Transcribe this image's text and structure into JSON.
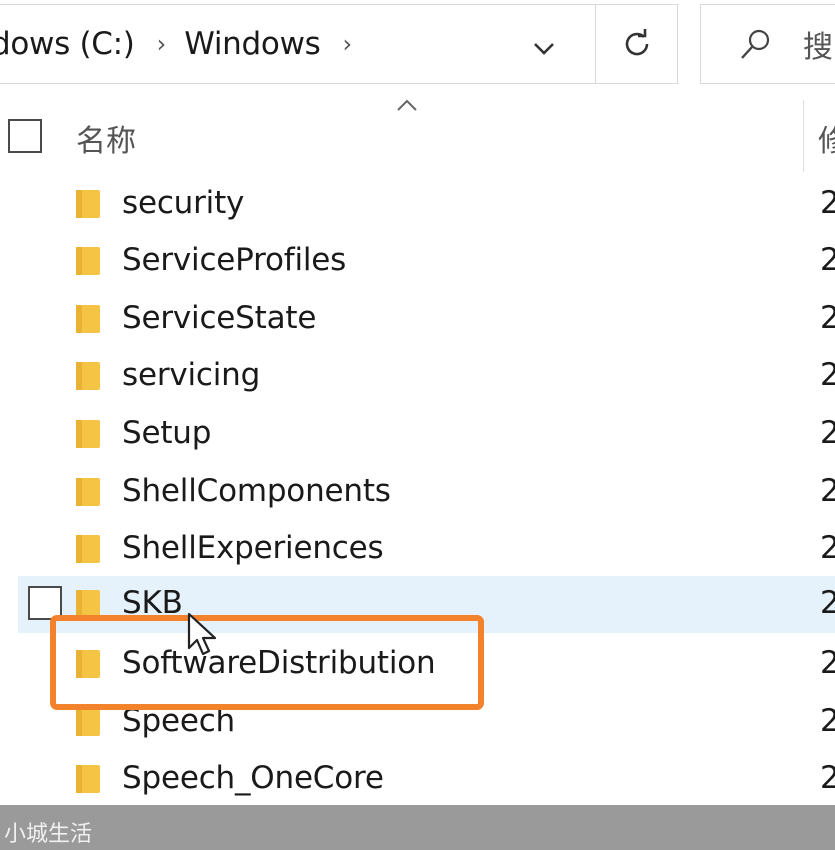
{
  "address_bar": {
    "drive_crumb": "dows (C:)",
    "folder_crumb": "Windows",
    "sep": "›"
  },
  "search": {
    "placeholder": "搜"
  },
  "header": {
    "name_label": "名称",
    "date_label": "修"
  },
  "rows": [
    {
      "name": "security",
      "date": "2"
    },
    {
      "name": "ServiceProfiles",
      "date": "2"
    },
    {
      "name": "ServiceState",
      "date": "2"
    },
    {
      "name": "servicing",
      "date": "2"
    },
    {
      "name": "Setup",
      "date": "2"
    },
    {
      "name": "ShellComponents",
      "date": "2"
    },
    {
      "name": "ShellExperiences",
      "date": "2"
    },
    {
      "name": "SKB",
      "date": "2"
    },
    {
      "name": "SoftwareDistribution",
      "date": "2"
    },
    {
      "name": "Speech",
      "date": "2"
    },
    {
      "name": "Speech_OneCore",
      "date": "2"
    }
  ],
  "watermark": "小城生活",
  "colors": {
    "folder": "#f6c445",
    "hover_row": "#e5f1fb",
    "highlight": "#f2822b"
  },
  "icons": [
    "chevron-down-icon",
    "refresh-icon",
    "search-icon",
    "folder-icon",
    "mouse-cursor-icon",
    "sort-up-icon"
  ]
}
